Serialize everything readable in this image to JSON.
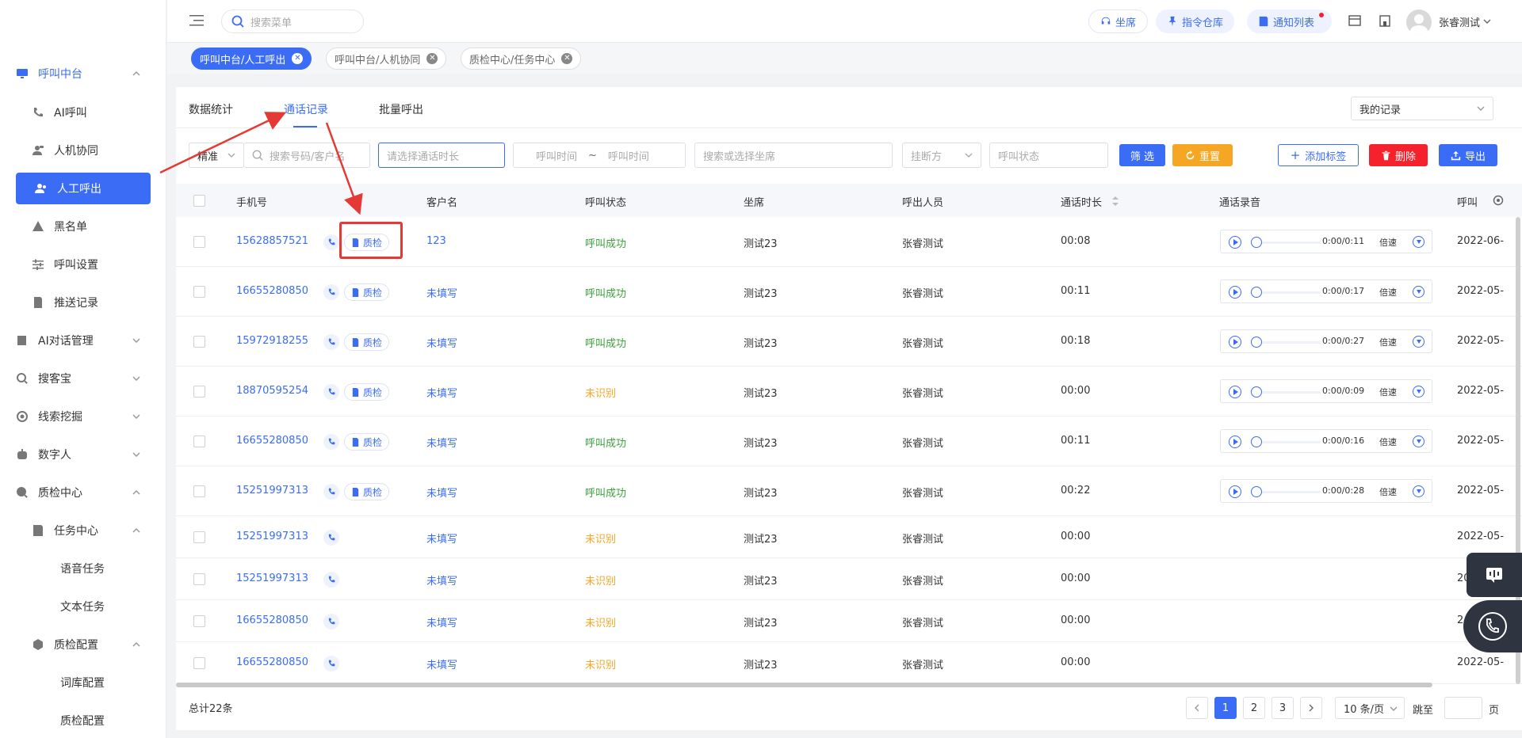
{
  "sidebar": {
    "items": [
      {
        "label": "呼叫中台",
        "icon": "monitor-icon"
      },
      {
        "label": "AI呼叫",
        "icon": "phone-icon"
      },
      {
        "label": "人机协同",
        "icon": "user-group-icon"
      },
      {
        "label": "人工呼出",
        "icon": "user-icon"
      },
      {
        "label": "黑名单",
        "icon": "warning-icon"
      },
      {
        "label": "呼叫设置",
        "icon": "sliders-icon"
      },
      {
        "label": "推送记录",
        "icon": "document-icon"
      },
      {
        "label": "AI对话管理",
        "icon": "book-icon"
      },
      {
        "label": "搜客宝",
        "icon": "search-circle-icon"
      },
      {
        "label": "线索挖掘",
        "icon": "target-icon"
      },
      {
        "label": "数字人",
        "icon": "robot-icon"
      },
      {
        "label": "质检中心",
        "icon": "magnifier-icon"
      },
      {
        "label": "任务中心",
        "icon": "task-icon"
      },
      {
        "label": "语音任务"
      },
      {
        "label": "文本任务"
      },
      {
        "label": "质检配置",
        "icon": "hexagon-icon"
      },
      {
        "label": "词库配置"
      },
      {
        "label": "质检配置"
      }
    ]
  },
  "header": {
    "search_placeholder": "搜索菜单",
    "seat_label": "坐席",
    "command_label": "指令仓库",
    "notice_label": "通知列表",
    "user_name": "张睿测试"
  },
  "tags": [
    {
      "label": "呼叫中台/人工呼出"
    },
    {
      "label": "呼叫中台/人机协同"
    },
    {
      "label": "质检中心/任务中心"
    }
  ],
  "tabs": {
    "stats": "数据统计",
    "records": "通话记录",
    "batch": "批量呼出",
    "my_records": "我的记录"
  },
  "filters": {
    "match": "精准",
    "search_placeholder": "搜索号码/客户名",
    "duration_placeholder": "请选择通话时长",
    "time_start": "呼叫时间",
    "time_sep": "~",
    "time_end": "呼叫时间",
    "seat_placeholder": "搜索或选择坐席",
    "hangup": "挂断方",
    "status_placeholder": "呼叫状态",
    "filter_btn": "筛 选",
    "reset_btn": "重置",
    "add_tag_btn": "添加标签",
    "delete_btn": "删除",
    "export_btn": "导出"
  },
  "table": {
    "headers": {
      "phone": "手机号",
      "customer": "客户名",
      "status": "呼叫状态",
      "seat": "坐席",
      "caller": "呼出人员",
      "duration": "通话时长",
      "recording": "通话录音",
      "time": "呼叫"
    },
    "qc_label": "质检",
    "speed_label": "倍速",
    "rows": [
      {
        "phone": "15628857521",
        "customer": "123",
        "status": "呼叫成功",
        "seat": "测试23",
        "caller": "张睿测试",
        "duration": "00:08",
        "rec_time": "0:00/0:11",
        "time": "2022-06-"
      },
      {
        "phone": "16655280850",
        "customer": "未填写",
        "status": "呼叫成功",
        "seat": "测试23",
        "caller": "张睿测试",
        "duration": "00:11",
        "rec_time": "0:00/0:17",
        "time": "2022-05-"
      },
      {
        "phone": "15972918255",
        "customer": "未填写",
        "status": "呼叫成功",
        "seat": "测试23",
        "caller": "张睿测试",
        "duration": "00:18",
        "rec_time": "0:00/0:27",
        "time": "2022-05-"
      },
      {
        "phone": "18870595254",
        "customer": "未填写",
        "status": "未识别",
        "seat": "测试23",
        "caller": "张睿测试",
        "duration": "00:00",
        "rec_time": "0:00/0:09",
        "time": "2022-05-"
      },
      {
        "phone": "16655280850",
        "customer": "未填写",
        "status": "呼叫成功",
        "seat": "测试23",
        "caller": "张睿测试",
        "duration": "00:11",
        "rec_time": "0:00/0:16",
        "time": "2022-05-"
      },
      {
        "phone": "15251997313",
        "customer": "未填写",
        "status": "呼叫成功",
        "seat": "测试23",
        "caller": "张睿测试",
        "duration": "00:22",
        "rec_time": "0:00/0:28",
        "time": "2022-05-"
      },
      {
        "phone": "15251997313",
        "customer": "未填写",
        "status": "未识别",
        "seat": "测试23",
        "caller": "张睿测试",
        "duration": "00:00",
        "time": "2022-05-"
      },
      {
        "phone": "15251997313",
        "customer": "未填写",
        "status": "未识别",
        "seat": "测试23",
        "caller": "张睿测试",
        "duration": "00:00",
        "time": "20"
      },
      {
        "phone": "16655280850",
        "customer": "未填写",
        "status": "未识别",
        "seat": "测试23",
        "caller": "张睿测试",
        "duration": "00:00",
        "time": "2"
      },
      {
        "phone": "16655280850",
        "customer": "未填写",
        "status": "未识别",
        "seat": "测试23",
        "caller": "张睿测试",
        "duration": "00:00",
        "time": "2022-05-"
      }
    ]
  },
  "pagination": {
    "total": "总计22条",
    "pages": [
      "1",
      "2",
      "3"
    ],
    "per_page": "10 条/页",
    "jump_label": "跳至",
    "page_unit": "页"
  },
  "colors": {
    "accent": "#3b6cf6",
    "success": "#3aa33a",
    "warning": "#f5a623",
    "danger": "#f5222d",
    "reset": "#f5a623",
    "annotation": "#e53935"
  }
}
